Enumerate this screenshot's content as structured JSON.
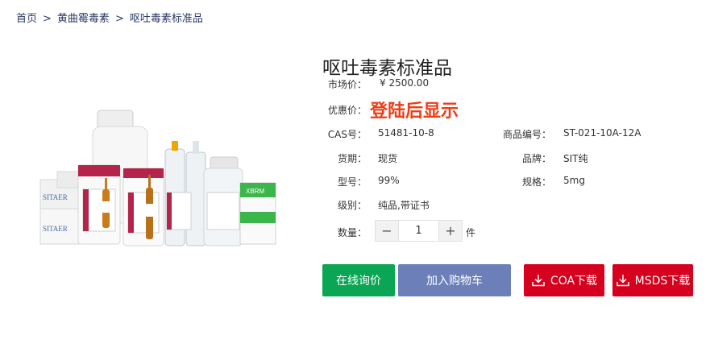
{
  "breadcrumb": {
    "home": "首页",
    "category": "黄曲霉毒素",
    "current": "呕吐毒素标准品",
    "separator": ">"
  },
  "product": {
    "title": "呕吐毒素标准品",
    "image_icon": "product-photo-icon",
    "image_labels": [
      "SITAER",
      "XBRM"
    ],
    "market_price_label": "市场价：",
    "market_price": "¥ 2500.00",
    "promo_price_label": "优惠价：",
    "promo_price_text": "登陆后显示",
    "cas_label": "CAS号：",
    "cas": "51481-10-8",
    "sku_label": "商品编号：",
    "sku": "ST-021-10A-12A",
    "stock_label": "货期：",
    "stock": "现货",
    "brand_label": "品牌：",
    "brand": "SIT纯",
    "model_label": "型号：",
    "model": "99%",
    "spec_label": "规格：",
    "spec": "5mg",
    "grade_label": "级别：",
    "grade": "纯品,带证书",
    "qty_label": "数量：",
    "qty": "1",
    "qty_unit": "件",
    "minus": "−",
    "plus": "+"
  },
  "actions": {
    "inquiry": "在线询价",
    "add_cart": "加入购物车",
    "coa": "COA下载",
    "msds": "MSDS下载"
  },
  "colors": {
    "inquiry_bg": "#0aa653",
    "cart_bg": "#6c7fb8",
    "download_bg": "#d6001e",
    "promo": "#ef3b16"
  }
}
